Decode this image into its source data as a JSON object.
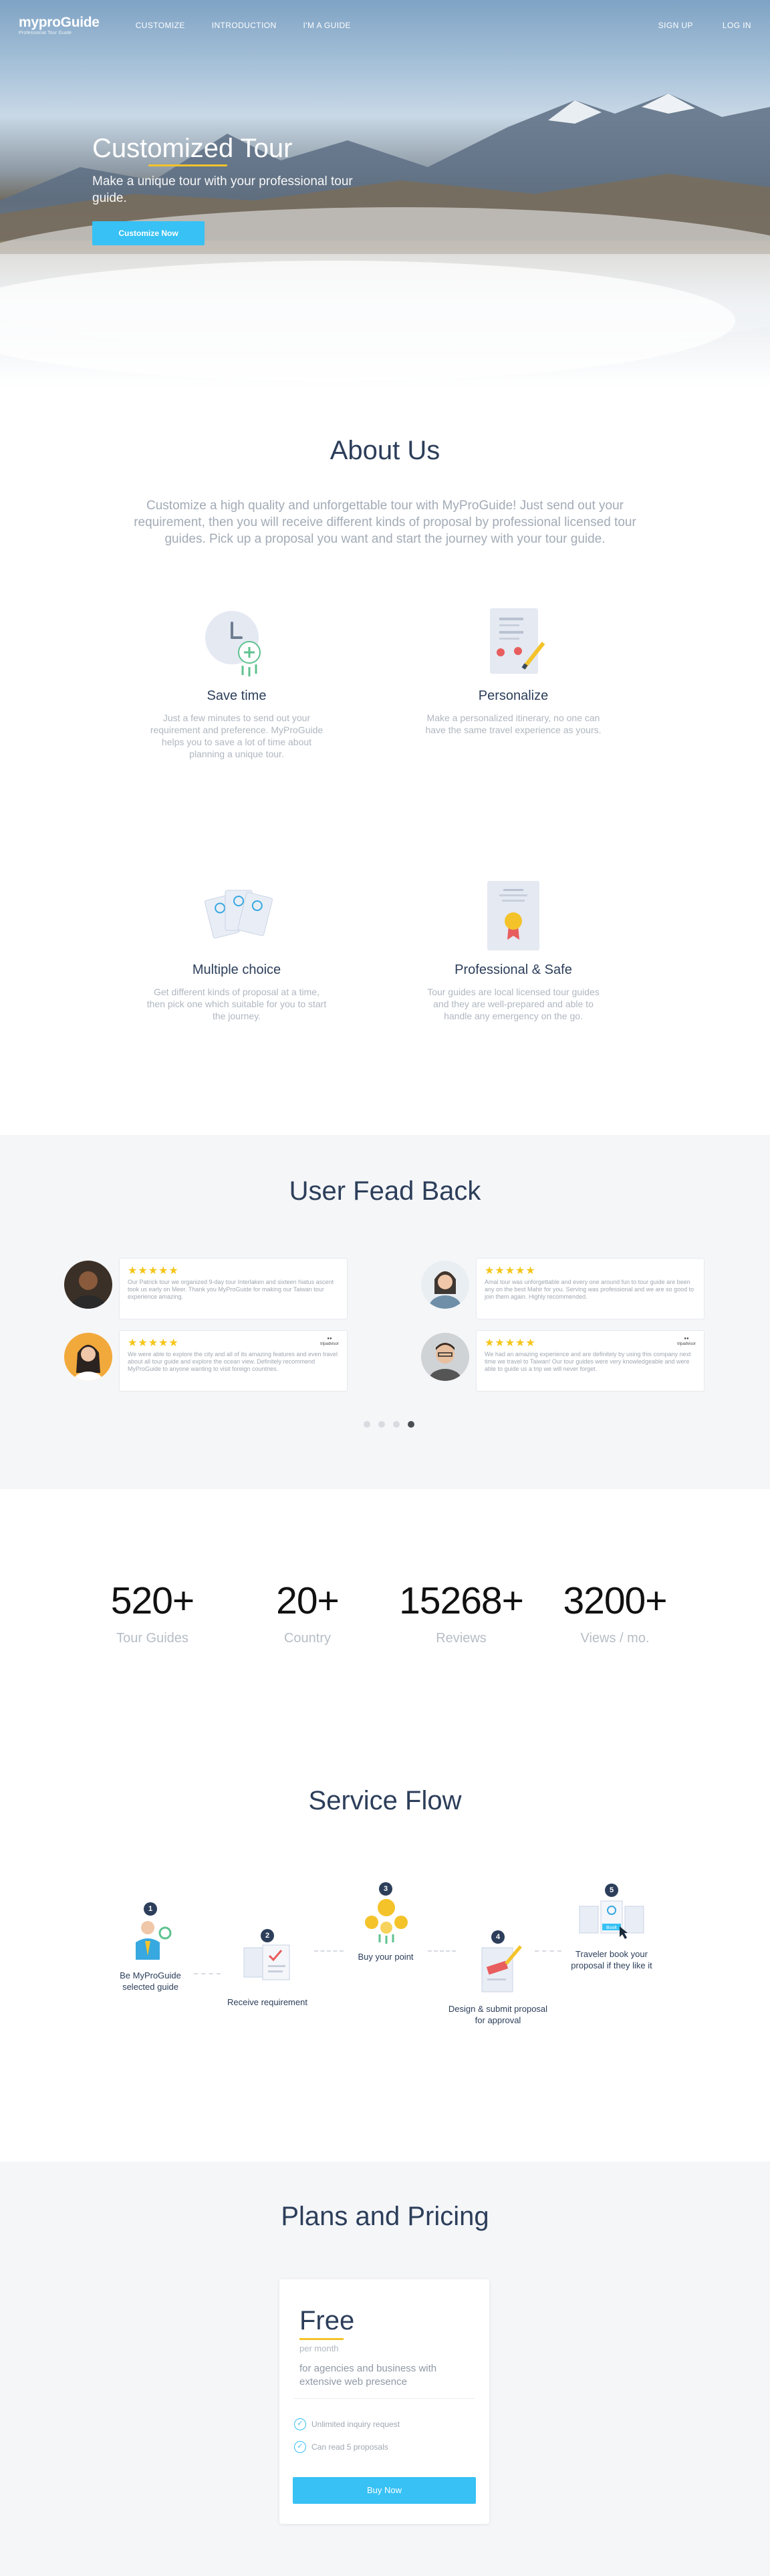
{
  "nav": {
    "logo": "myproGuide",
    "logo_tagline": "Professional Tour Guide",
    "links": [
      "CUSTOMIZE",
      "INTRODUCTION",
      "I'M A GUIDE"
    ],
    "sign_up": "SIGN UP",
    "log_in": "LOG IN"
  },
  "hero": {
    "title": "Customized Tour",
    "subtitle": "Make a unique tour with your professional tour guide.",
    "cta": "Customize Now"
  },
  "about": {
    "title": "About Us",
    "description": "Customize a high quality and unforgettable tour with MyProGuide! Just send out your requirement, then you will receive different kinds of proposal by professional licensed tour guides. Pick up a proposal you want and start the journey with your tour guide.",
    "features": [
      {
        "icon": "clock-icon",
        "title": "Save time",
        "text": "Just a few minutes to send out your requirement and preference. MyProGuide helps you to save a lot of time about planning a unique tour."
      },
      {
        "icon": "map-itinerary-icon",
        "title": "Personalize",
        "text": "Make a personalized itinerary, no one can have the same travel experience as yours."
      },
      {
        "icon": "proposals-icon",
        "title": "Multiple choice",
        "text": "Get different kinds of proposal at a time, then pick one which suitable for you to start the journey."
      },
      {
        "icon": "certificate-icon",
        "title": "Professional & Safe",
        "text": "Tour guides are local licensed tour guides and they are well-prepared and able to handle any emergency on the go."
      }
    ]
  },
  "feedback": {
    "title": "User Fead Back",
    "stars": "★★★★★",
    "tripadvisor": "tripadvisor",
    "reviews": [
      {
        "text": "Our Patrick tour we organized 9-day tour Interlaken and sixteen hiatus ascent took us early on Meer. Thank you MyProGuide for making our Taiwan tour experience amazing."
      },
      {
        "text": "Amal tour was unforgettable and every one around fun to tour guide are been any on the best Mahir for you. Serving was professional and we are so good to join them again. Highly recommended."
      },
      {
        "text": "We were able to explore the city and all of its amazing features and even travel about all tour guide and explore the ocean view. Definitely recommend MyProGuide to anyone wanting to visit foreign countries."
      },
      {
        "text": "We had an amazing experience and are definitely by using this company next time we travel to Taiwan! Our tour guides were very knowledgeable and were able to guide us a trip we will never forget."
      }
    ]
  },
  "stats": [
    {
      "value": "520+",
      "label": "Tour Guides"
    },
    {
      "value": "20+",
      "label": "Country"
    },
    {
      "value": "15268+",
      "label": "Reviews"
    },
    {
      "value": "3200+",
      "label": "Views / mo."
    }
  ],
  "flow": {
    "title": "Service Flow",
    "steps": [
      {
        "num": "1",
        "label": "Be MyProGuide selected guide"
      },
      {
        "num": "2",
        "label": "Receive requirement"
      },
      {
        "num": "3",
        "label": "Buy your point"
      },
      {
        "num": "4",
        "label": "Design & submit proposal for approval"
      },
      {
        "num": "5",
        "label": "Traveler book your proposal if they like it"
      }
    ],
    "book_badge": "Book"
  },
  "pricing": {
    "title": "Plans and Pricing",
    "plan_name": "Free",
    "period": "per month",
    "description": "for agencies and business with extensive  web presence",
    "features": [
      "Unlimited inquiry request",
      "Can read 5 proposals"
    ],
    "cta": "Buy Now"
  },
  "colors": {
    "accent": "#37c1f5",
    "highlight": "#f4c32a",
    "heading": "#2c3e5a"
  }
}
